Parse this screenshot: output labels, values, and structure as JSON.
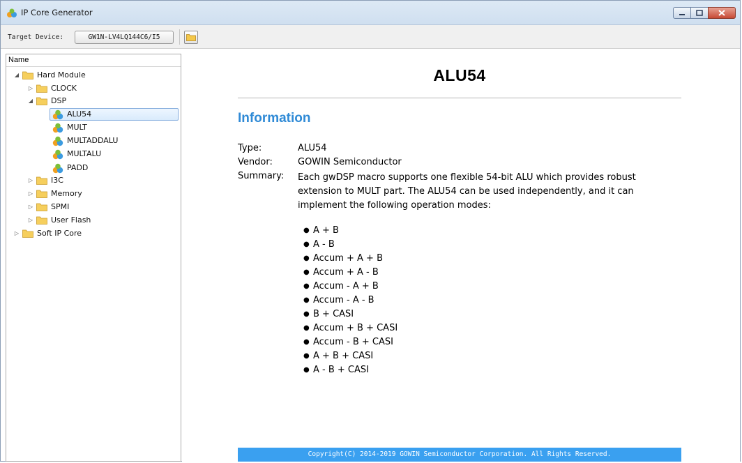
{
  "window": {
    "title": "IP Core Generator"
  },
  "toolbar": {
    "target_label": "Target Device:",
    "device": "GW1N-LV4LQ144C6/I5"
  },
  "tree": {
    "header": "Name",
    "nodes": [
      {
        "label": "Hard Module",
        "type": "folder",
        "expanded": true
      },
      {
        "label": "CLOCK",
        "type": "folder",
        "expanded": false
      },
      {
        "label": "DSP",
        "type": "folder",
        "expanded": true
      },
      {
        "label": "ALU54",
        "type": "ip",
        "selected": true
      },
      {
        "label": "MULT",
        "type": "ip"
      },
      {
        "label": "MULTADDALU",
        "type": "ip"
      },
      {
        "label": "MULTALU",
        "type": "ip"
      },
      {
        "label": "PADD",
        "type": "ip"
      },
      {
        "label": "I3C",
        "type": "folder",
        "expanded": false
      },
      {
        "label": "Memory",
        "type": "folder",
        "expanded": false
      },
      {
        "label": "SPMI",
        "type": "folder",
        "expanded": false
      },
      {
        "label": "User Flash",
        "type": "folder",
        "expanded": false
      },
      {
        "label": "Soft IP Core",
        "type": "folder",
        "expanded": false
      }
    ]
  },
  "doc": {
    "title": "ALU54",
    "section": "Information",
    "type_key": "Type:",
    "type_val": "ALU54",
    "vendor_key": "Vendor:",
    "vendor_val": "GOWIN Semiconductor",
    "summary_key": "Summary:",
    "summary_val": "Each gwDSP macro supports one flexible 54-bit ALU which provides robust extension to MULT part. The ALU54 can be used independently, and it can implement the following operation modes:",
    "modes": [
      "A + B",
      "A - B",
      "Accum + A + B",
      "Accum + A - B",
      "Accum - A + B",
      "Accum - A - B",
      "B + CASI",
      "Accum + B + CASI",
      "Accum - B + CASI",
      "A + B + CASI",
      "A - B + CASI"
    ],
    "footer": "Copyright(C) 2014-2019 GOWIN Semiconductor Corporation. All Rights Reserved."
  },
  "colors": {
    "heading": "#2f8ad6",
    "footer_bg": "#3aa0f0"
  }
}
